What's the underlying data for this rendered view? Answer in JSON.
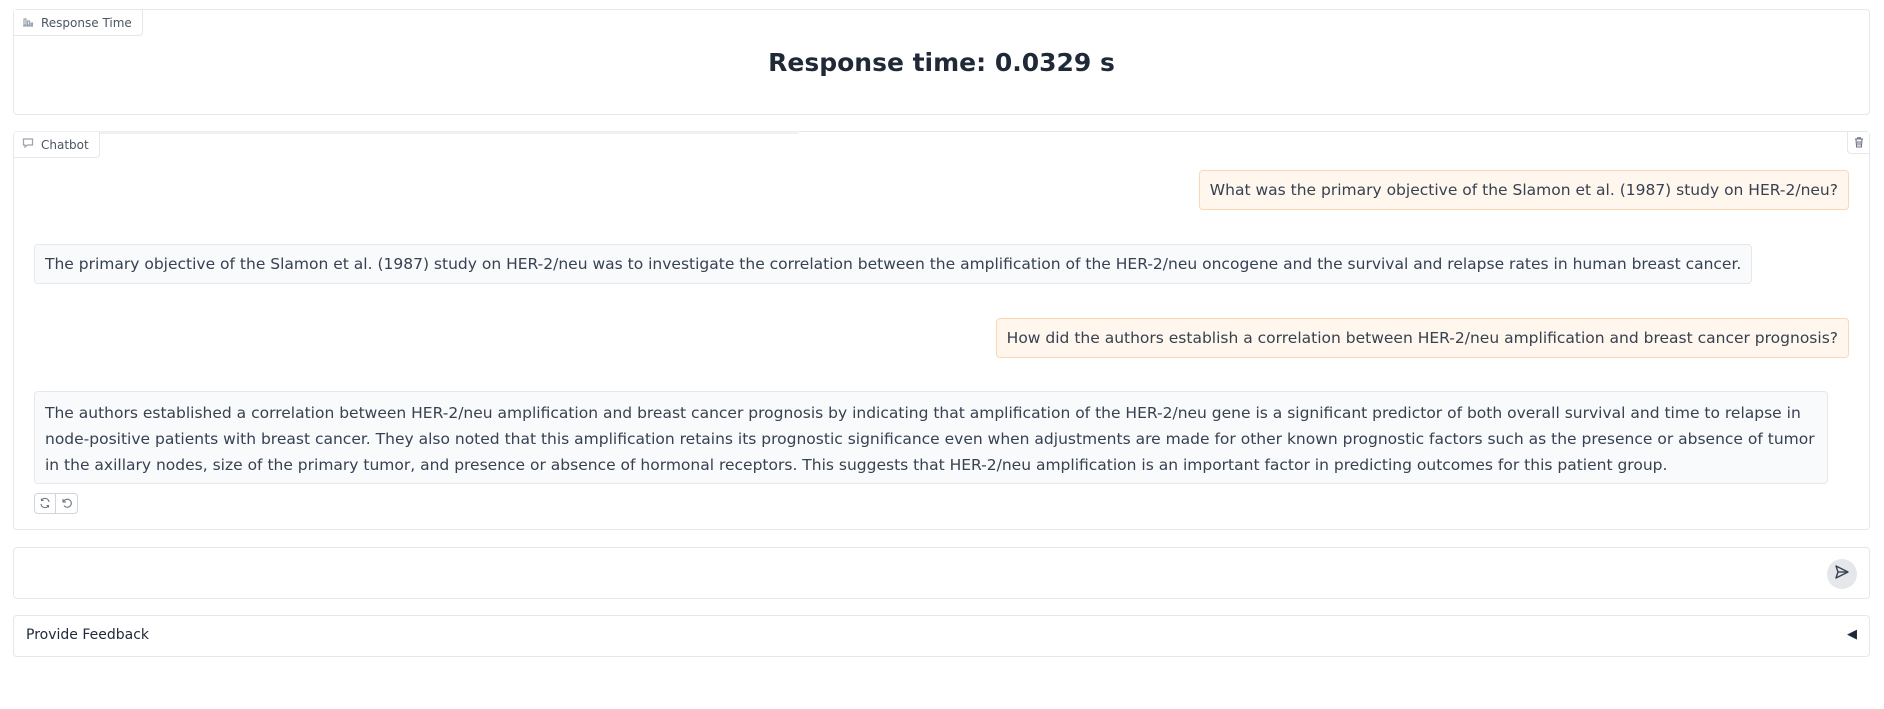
{
  "response_time": {
    "tab_label": "Response Time",
    "text": "Response time: 0.0329 s"
  },
  "chatbot": {
    "tab_label": "Chatbot",
    "messages": [
      {
        "role": "user",
        "text": "What was the primary objective of the Slamon et al. (1987) study on HER-2/neu?"
      },
      {
        "role": "bot",
        "text": "The primary objective of the Slamon et al. (1987) study on HER-2/neu was to investigate the correlation between the amplification of the HER-2/neu oncogene and the survival and relapse rates in human breast cancer."
      },
      {
        "role": "user",
        "text": "How did the authors establish a correlation between HER-2/neu amplification and breast cancer prognosis?"
      },
      {
        "role": "bot",
        "text": "The authors established a correlation between HER-2/neu amplification and breast cancer prognosis by indicating that amplification of the HER-2/neu gene is a significant predictor of both overall survival and time to relapse in node-positive patients with breast cancer. They also noted that this amplification retains its prognostic significance even when adjustments are made for other known prognostic factors such as the presence or absence of tumor in the axillary nodes, size of the primary tumor, and presence or absence of hormonal receptors. This suggests that HER-2/neu amplification is an important factor in predicting outcomes for this patient group."
      }
    ]
  },
  "input": {
    "value": "",
    "placeholder": ""
  },
  "feedback": {
    "label": "Provide Feedback",
    "arrow": "◀"
  },
  "icons": {
    "response_tab": "bar-chart-icon",
    "chat_tab": "chat-bubble-icon",
    "clear": "trash-icon",
    "retry": "retry-icon",
    "undo": "undo-icon",
    "send": "send-icon"
  },
  "colors": {
    "user_bubble_bg": "#fff7ed",
    "user_bubble_border": "#fbd7b4",
    "bot_bubble_bg": "#f9fafb",
    "border": "#e5e7eb"
  }
}
